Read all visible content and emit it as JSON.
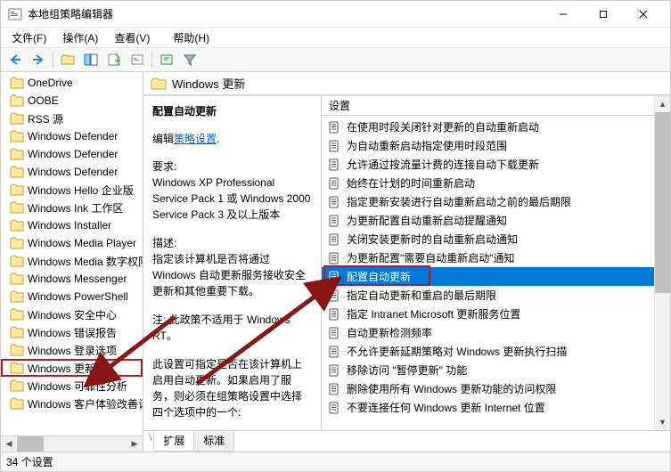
{
  "window": {
    "title": "本地组策略编辑器"
  },
  "menubar": {
    "file": "文件(F)",
    "action": "操作(A)",
    "view": "查看(V)",
    "help": "帮助(H)"
  },
  "tree": {
    "items": [
      "OneDrive",
      "OOBE",
      "RSS 源",
      "Windows Defender",
      "Windows Defender",
      "Windows Defender",
      "Windows Hello 企业版",
      "Windows Ink 工作区",
      "Windows Installer",
      "Windows Media Player",
      "Windows Media 数字权限管理",
      "Windows Messenger",
      "Windows PowerShell",
      "Windows 安全中心",
      "Windows 错误报告",
      "Windows 登录选项",
      "Windows 更新",
      "Windows 可靠性分析",
      "Windows 客户体验改善计划"
    ],
    "selected_index": 16
  },
  "detail": {
    "header": "Windows 更新",
    "desc": {
      "title": "配置自动更新",
      "edit_prefix": "编辑",
      "edit_link": "策略设置",
      "req_label": "要求:",
      "req_body": "Windows XP Professional Service Pack 1 或 Windows 2000 Service Pack 3 及以上版本",
      "desc_label": "描述:",
      "desc_body": "指定该计算机是否将通过 Windows 自动更新服务接收安全更新和其他重要下载。",
      "note": "注: 此政策不适用于 Windows RT。",
      "more": "此设置可指定是否在该计算机上启用自动更新。如果启用了服务，则必须在组策略设置中选择四个选项中的一个:"
    },
    "settings_header": "设置",
    "settings": [
      "在使用时段关闭针对更新的自动重新启动",
      "为自动重新启动指定使用时段范围",
      "允许通过按流量计费的连接自动下载更新",
      "始终在计划的时间重新启动",
      "指定更新安装进行自动重新启动之前的最后期限",
      "为更新配置自动重新启动提醒通知",
      "关闭安装更新时的自动重新启动通知",
      "为更新配置\"需要自动重新启动\"通知",
      "配置自动更新",
      "指定自动更新和重启的最后期限",
      "指定 Intranet Microsoft 更新服务位置",
      "自动更新检测频率",
      "不允许更新延期策略对 Windows 更新执行扫描",
      "移除访问 \"暂停更新\" 功能",
      "删除使用所有 Windows 更新功能的访问权限",
      "不要连接任何 Windows 更新 Internet 位置"
    ],
    "selected_setting_index": 8
  },
  "tabs": {
    "extended": "扩展",
    "standard": "标准"
  },
  "statusbar": {
    "text": "34 个设置"
  }
}
